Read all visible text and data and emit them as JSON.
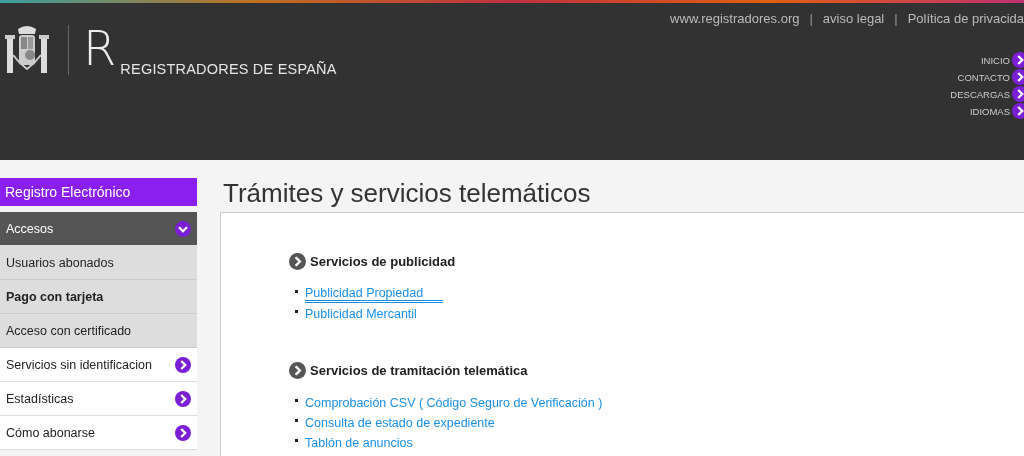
{
  "header": {
    "logo": {
      "mark": "R",
      "name": "REGISTRADORES DE ESPAÑA"
    },
    "top_links": [
      {
        "kind": "link",
        "text": "www.registradores.org"
      },
      {
        "kind": "separator",
        "text": "|"
      },
      {
        "kind": "link",
        "text": "aviso legal"
      },
      {
        "kind": "separator",
        "text": "|"
      },
      {
        "kind": "link",
        "text": "Política de privacida"
      }
    ],
    "nav": [
      "INICIO",
      "CONTACTO",
      "DESCARGAS",
      "IDIOMAS"
    ]
  },
  "sidebar": {
    "title": "Registro Electrónico",
    "items": [
      {
        "kind": "group",
        "label": "Accesos",
        "expanded": true,
        "selected": false
      },
      {
        "kind": "sub",
        "label": "Usuarios abonados",
        "selected": false
      },
      {
        "kind": "sub",
        "label": "Pago con tarjeta",
        "selected": true
      },
      {
        "kind": "sub",
        "label": "Acceso con certificado",
        "selected": false
      },
      {
        "kind": "link",
        "label": "Servicios sin identificacion",
        "selected": false
      },
      {
        "kind": "link",
        "label": "Estadísticas",
        "selected": false
      },
      {
        "kind": "link",
        "label": "Cómo abonarse",
        "selected": false
      }
    ]
  },
  "page_title": "Trámites y servicios telemáticos",
  "sections": [
    {
      "title": "Servicios de publicidad",
      "links": [
        {
          "text": "Publicidad Propiedad",
          "focused": true
        },
        {
          "text": "Publicidad Mercantil",
          "focused": false
        }
      ]
    },
    {
      "title": "Servicios de tramitación telemática",
      "links": [
        {
          "text": "Comprobación CSV ( Código Seguro de Verificación )",
          "focused": false
        },
        {
          "text": "Consulta de estado de expediente",
          "focused": false
        },
        {
          "text": "Tablón de anuncios",
          "focused": false
        }
      ]
    }
  ]
}
